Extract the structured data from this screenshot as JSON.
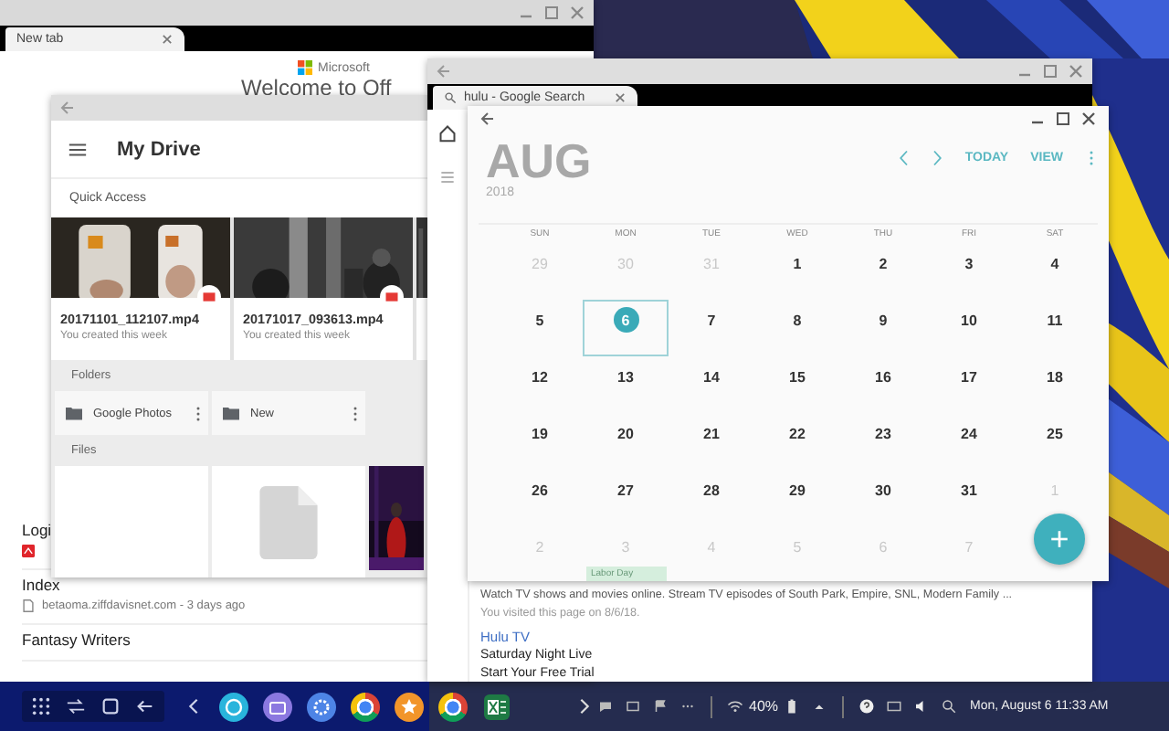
{
  "back_browser": {
    "tab": "New tab",
    "logo": "Microsoft",
    "heading": "Welcome to Off",
    "history": [
      {
        "title": "Logi",
        "kind": "pdf"
      },
      {
        "title": "Index",
        "kind": "page",
        "source": "betaoma.ziffdavisnet.com - 3 days ago"
      },
      {
        "title": "Fantasy Writers"
      }
    ]
  },
  "drive": {
    "title": "My Drive",
    "quick_access_label": "Quick Access",
    "quick_access": [
      {
        "kind": "video",
        "name": "20171101_112107.mp4",
        "detail": "You created this week"
      },
      {
        "kind": "video",
        "name": "20171017_093613.mp4",
        "detail": "You created this week"
      },
      {
        "kind": "picture"
      }
    ],
    "folders_label": "Folders",
    "folders": [
      {
        "name": "Google Photos"
      },
      {
        "name": "New"
      }
    ],
    "files_label": "Files",
    "files": [
      {
        "kind": "blank"
      },
      {
        "kind": "document"
      },
      {
        "kind": "picture"
      }
    ]
  },
  "hulu_browser": {
    "tab": "hulu - Google Search",
    "results": [
      {
        "kind": "snippet",
        "text": "Watch TV shows and movies online. Stream TV episodes of South Park, Empire, SNL, Modern Family ..."
      },
      {
        "kind": "meta",
        "text": "You visited this page on 8/6/18."
      },
      {
        "kind": "link",
        "text": "Hulu TV"
      },
      {
        "kind": "title",
        "text": "Saturday Night Live"
      },
      {
        "kind": "title",
        "text": "Start Your Free Trial"
      }
    ]
  },
  "calendar": {
    "month": "AUG",
    "year": "2018",
    "actions": [
      "TODAY",
      "VIEW"
    ],
    "weekdays": [
      "SUN",
      "MON",
      "TUE",
      "WED",
      "THU",
      "FRI",
      "SAT"
    ],
    "weeks": [
      [
        {
          "d": "29",
          "outside": true,
          "selected": false
        },
        {
          "d": "30",
          "outside": true,
          "selected": false
        },
        {
          "d": "31",
          "outside": true,
          "selected": false
        },
        {
          "d": "1",
          "outside": false,
          "selected": false
        },
        {
          "d": "2",
          "outside": false,
          "selected": false
        },
        {
          "d": "3",
          "outside": false,
          "selected": false
        },
        {
          "d": "4",
          "outside": false,
          "selected": false
        }
      ],
      [
        {
          "d": "5",
          "outside": false,
          "selected": false
        },
        {
          "d": "6",
          "outside": false,
          "selected": true
        },
        {
          "d": "7",
          "outside": false,
          "selected": false
        },
        {
          "d": "8",
          "outside": false,
          "selected": false
        },
        {
          "d": "9",
          "outside": false,
          "selected": false
        },
        {
          "d": "10",
          "outside": false,
          "selected": false
        },
        {
          "d": "11",
          "outside": false,
          "selected": false
        }
      ],
      [
        {
          "d": "12",
          "outside": false,
          "selected": false
        },
        {
          "d": "13",
          "outside": false,
          "selected": false
        },
        {
          "d": "14",
          "outside": false,
          "selected": false
        },
        {
          "d": "15",
          "outside": false,
          "selected": false
        },
        {
          "d": "16",
          "outside": false,
          "selected": false
        },
        {
          "d": "17",
          "outside": false,
          "selected": false
        },
        {
          "d": "18",
          "outside": false,
          "selected": false
        }
      ],
      [
        {
          "d": "19",
          "outside": false,
          "selected": false
        },
        {
          "d": "20",
          "outside": false,
          "selected": false
        },
        {
          "d": "21",
          "outside": false,
          "selected": false
        },
        {
          "d": "22",
          "outside": false,
          "selected": false
        },
        {
          "d": "23",
          "outside": false,
          "selected": false
        },
        {
          "d": "24",
          "outside": false,
          "selected": false
        },
        {
          "d": "25",
          "outside": false,
          "selected": false
        }
      ],
      [
        {
          "d": "26",
          "outside": false,
          "selected": false
        },
        {
          "d": "27",
          "outside": false,
          "selected": false
        },
        {
          "d": "28",
          "outside": false,
          "selected": false
        },
        {
          "d": "29",
          "outside": false,
          "selected": false
        },
        {
          "d": "30",
          "outside": false,
          "selected": false
        },
        {
          "d": "31",
          "outside": false,
          "selected": false
        },
        {
          "d": "1",
          "outside": true,
          "selected": false
        }
      ],
      [
        {
          "d": "2",
          "outside": true,
          "selected": false
        },
        {
          "d": "3",
          "outside": true,
          "selected": false,
          "event": "Labor Day"
        },
        {
          "d": "4",
          "outside": true,
          "selected": false
        },
        {
          "d": "5",
          "outside": true,
          "selected": false
        },
        {
          "d": "6",
          "outside": true,
          "selected": false
        },
        {
          "d": "7",
          "outside": true,
          "selected": false
        }
      ]
    ],
    "fab": "+"
  },
  "taskbar": {
    "apps": [
      {
        "kind": "clock"
      },
      {
        "kind": "camera"
      },
      {
        "kind": "gear"
      },
      {
        "kind": "chrome"
      },
      {
        "kind": "star"
      },
      {
        "kind": "chrome"
      },
      {
        "kind": "excel"
      }
    ],
    "battery": "40%",
    "clock": "Mon, August 6  11:33 AM"
  }
}
